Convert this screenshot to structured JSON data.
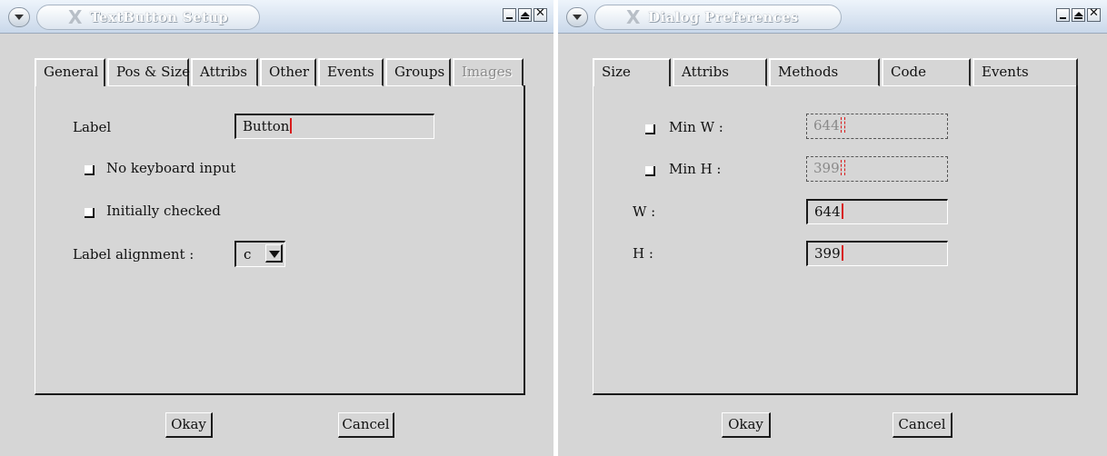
{
  "left_window": {
    "title": "TextButton Setup",
    "tabs": [
      {
        "label": "General",
        "active": true
      },
      {
        "label": "Pos & Size"
      },
      {
        "label": "Attribs"
      },
      {
        "label": "Other"
      },
      {
        "label": "Events"
      },
      {
        "label": "Groups"
      },
      {
        "label": "Images",
        "disabled": true
      }
    ],
    "label_field": {
      "label": "Label",
      "value": "Button"
    },
    "checkboxes": [
      {
        "label": "No keyboard input",
        "checked": false
      },
      {
        "label": "Initially checked",
        "checked": false
      }
    ],
    "alignment": {
      "label": "Label alignment :",
      "value": "c"
    },
    "okay": "Okay",
    "cancel": "Cancel"
  },
  "right_window": {
    "title": "Dialog Preferences",
    "tabs": [
      {
        "label": "Size",
        "active": true
      },
      {
        "label": "Attribs"
      },
      {
        "label": "Methods"
      },
      {
        "label": "Code"
      },
      {
        "label": "Events"
      }
    ],
    "min_w": {
      "label": "Min W :",
      "value": "644",
      "checked": false,
      "disabled": true
    },
    "min_h": {
      "label": "Min H :",
      "value": "399",
      "checked": false,
      "disabled": true
    },
    "w": {
      "label": "W :",
      "value": "644"
    },
    "h": {
      "label": "H :",
      "value": "399"
    },
    "okay": "Okay",
    "cancel": "Cancel"
  },
  "icons": {
    "window_menu": "chevron-down-icon",
    "x_logo": "x-logo-icon",
    "minimize": "minimize-icon",
    "maximize": "maximize-icon",
    "close": "close-icon"
  }
}
